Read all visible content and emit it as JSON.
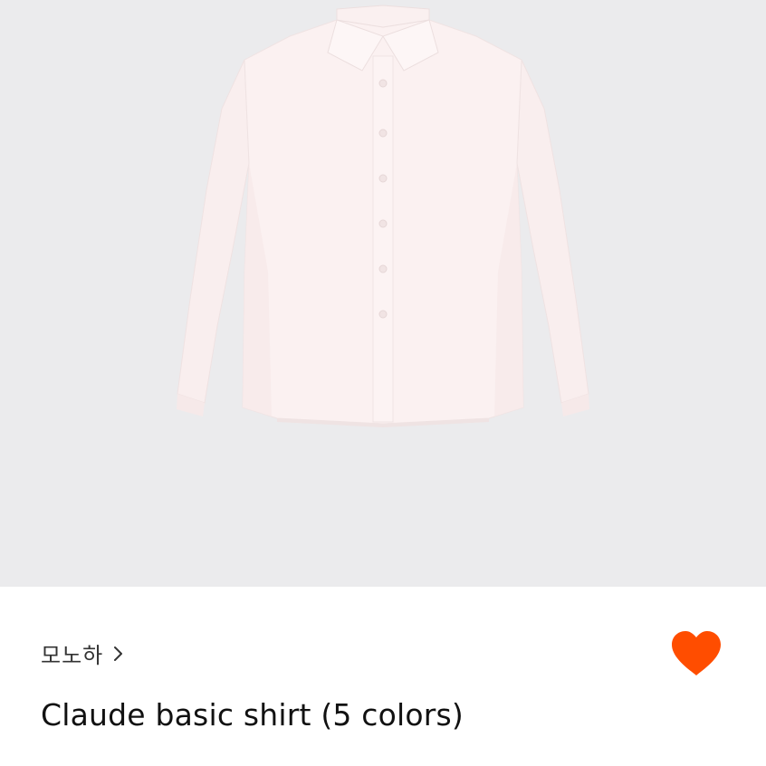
{
  "product": {
    "image_name": "shirt-image",
    "seller_name": "모노하",
    "title": "Claude basic shirt (5 colors)",
    "favorited": true
  },
  "colors": {
    "image_background": "#ebebed",
    "shirt": "#fbf1f1",
    "heart": "#ff4d00"
  },
  "icons": {
    "seller_chevron": "chevron-right-icon",
    "favorite": "heart-icon"
  }
}
